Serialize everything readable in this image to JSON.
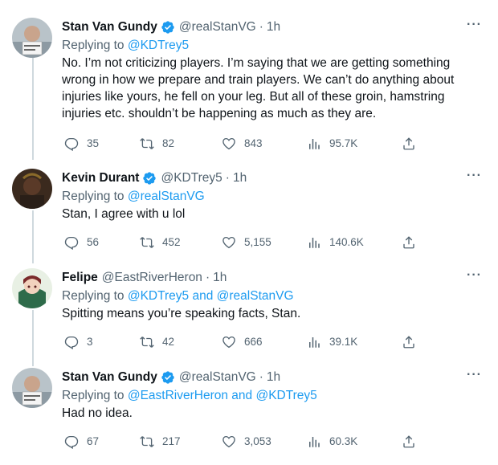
{
  "tweets": [
    {
      "name": "Stan Van Gundy",
      "verified": true,
      "handle": "@realStanVG",
      "time": "1h",
      "replying_prefix": "Replying to ",
      "mentions": "@KDTrey5",
      "text": "No. I’m not criticizing players. I’m saying that we are getting something wrong in how we prepare and train players. We can’t do anything about injuries like yours, he fell on your leg. But all of these groin, hamstring injuries etc. shouldn’t be happening as much as they are.",
      "replies": "35",
      "retweets": "82",
      "likes": "843",
      "views": "95.7K"
    },
    {
      "name": "Kevin Durant",
      "verified": true,
      "handle": "@KDTrey5",
      "time": "1h",
      "replying_prefix": "Replying to ",
      "mentions": "@realStanVG",
      "text": "Stan, I agree with u lol",
      "replies": "56",
      "retweets": "452",
      "likes": "5,155",
      "views": "140.6K"
    },
    {
      "name": "Felipe",
      "verified": false,
      "handle": "@EastRiverHeron",
      "time": "1h",
      "replying_prefix": "Replying to ",
      "mentions": "@KDTrey5 and @realStanVG",
      "text": "Spitting means you’re speaking facts, Stan.",
      "replies": "3",
      "retweets": "42",
      "likes": "666",
      "views": "39.1K"
    },
    {
      "name": "Stan Van Gundy",
      "verified": true,
      "handle": "@realStanVG",
      "time": "1h",
      "replying_prefix": "Replying to ",
      "mentions": "@EastRiverHeron and @KDTrey5",
      "text": "Had no idea.",
      "replies": "67",
      "retweets": "217",
      "likes": "3,053",
      "views": "60.3K"
    }
  ],
  "separator": "·",
  "more_glyph": "···",
  "colors": {
    "link": "#1d9bf0",
    "muted": "#536471",
    "text": "#0f1419",
    "thread": "#cfd9de"
  }
}
